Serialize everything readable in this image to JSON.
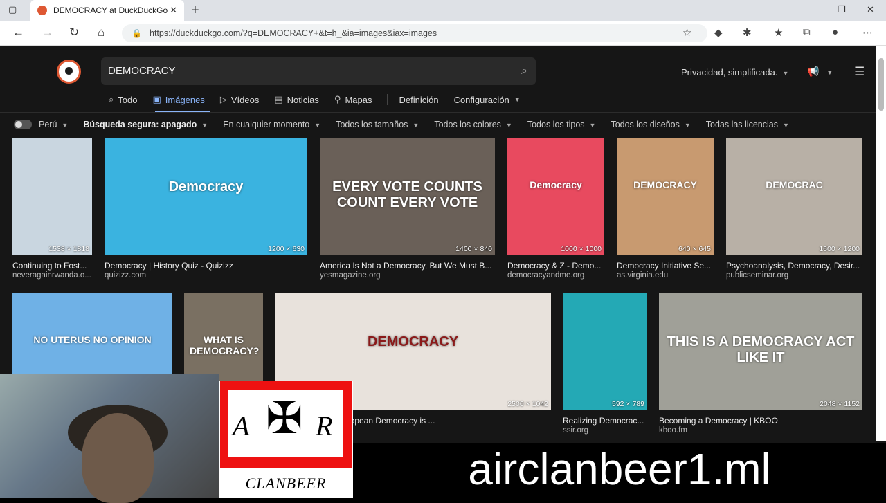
{
  "browser": {
    "tab_title": "DEMOCRACY at DuckDuckGo",
    "url": "https://duckduckgo.com/?q=DEMOCRACY+&t=h_&ia=images&iax=images"
  },
  "search": {
    "query": "DEMOCRACY"
  },
  "header": {
    "privacy_label": "Privacidad, simplificada."
  },
  "nav_tabs": [
    {
      "label": "Todo",
      "icon": "search-icon"
    },
    {
      "label": "Imágenes",
      "icon": "image-icon",
      "active": true
    },
    {
      "label": "Vídeos",
      "icon": "play-icon"
    },
    {
      "label": "Noticias",
      "icon": "newspaper-icon"
    },
    {
      "label": "Mapas",
      "icon": "map-pin-icon"
    },
    {
      "label": "Definición"
    },
    {
      "label": "Configuración"
    }
  ],
  "filters": {
    "region": "Perú",
    "safe_search": "Búsqueda segura: apagado",
    "time": "En cualquier momento",
    "size": "Todos los tamaños",
    "color": "Todos los colores",
    "type": "Todos los tipos",
    "layout": "Todos los diseños",
    "license": "Todas las licencias"
  },
  "results": [
    {
      "title": "Continuing to Fost...",
      "source": "neveragainrwanda.o...",
      "dims": "1538 × 1818",
      "color": "#c9d6e0"
    },
    {
      "title": "Democracy | History Quiz - Quizizz",
      "source": "quizizz.com",
      "dims": "1200 × 630",
      "color": "#3ab3e0",
      "label": "Democracy"
    },
    {
      "title": "America Is Not a Democracy, But We Must B...",
      "source": "yesmagazine.org",
      "dims": "1400 × 840",
      "color": "#6a6058",
      "label": "EVERY VOTE COUNTS COUNT EVERY VOTE"
    },
    {
      "title": "Democracy & Z - Demo...",
      "source": "democracyandme.org",
      "dims": "1000 × 1000",
      "color": "#e84a5f",
      "label": "Democracy"
    },
    {
      "title": "Democracy Initiative Se...",
      "source": "as.virginia.edu",
      "dims": "640 × 645",
      "color": "#c89a70",
      "label": "DEMOCRACY"
    },
    {
      "title": "Psychoanalysis, Democracy, Desir...",
      "source": "publicseminar.org",
      "dims": "1600 × 1200",
      "color": "#b8b0a6",
      "label": "DEMOCRAC"
    },
    {
      "title": "",
      "source": "",
      "dims": "",
      "color": "#6fb1e6",
      "label": "NO UTERUS NO OPINION"
    },
    {
      "title": "",
      "source": "",
      "dims": "",
      "color": "#7a7062",
      "label": "WHAT IS DEMOCRACY?"
    },
    {
      "title": "...cracy is a tool. European Democracy is ...",
      "source": "",
      "dims": "2500 × 1042",
      "color": "#e8e2dc",
      "label": "DEMOCRACY"
    },
    {
      "title": "Realizing Democrac...",
      "source": "ssir.org",
      "dims": "592 × 789",
      "color": "#24a9b5"
    },
    {
      "title": "Becoming a Democracy | KBOO",
      "source": "kboo.fm",
      "dims": "2048 × 1152",
      "color": "#a0a098",
      "label": "THIS IS A DEMOCRACY ACT LIKE IT"
    }
  ],
  "overlay": {
    "clan_letters": [
      "A",
      "R"
    ],
    "clan_name": "CLANBEER",
    "banner": "airclanbeer1.ml"
  }
}
